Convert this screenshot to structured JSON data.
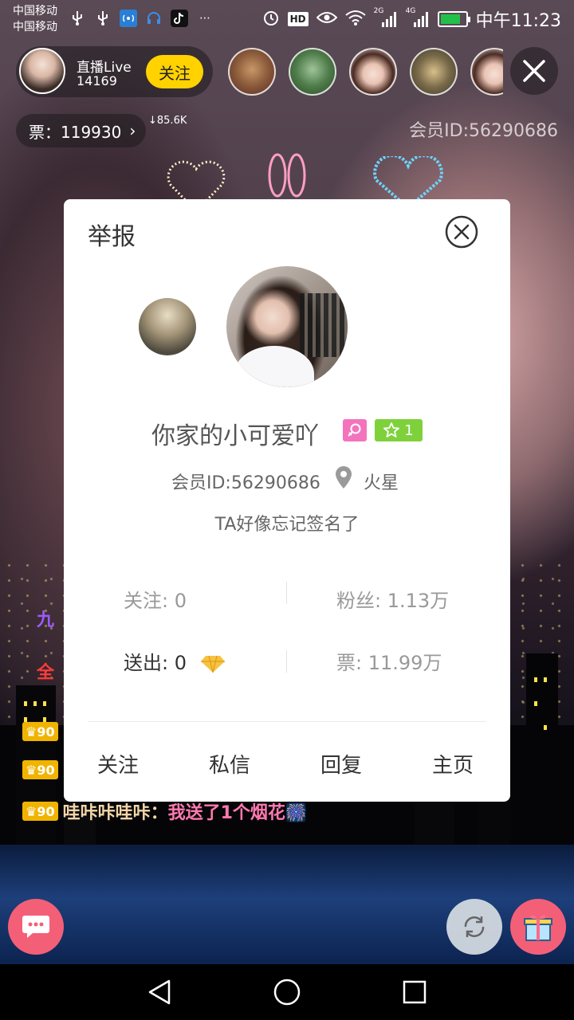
{
  "status_bar": {
    "carrier_1": "中国移动",
    "carrier_2": "中国移动",
    "network_1": "2G",
    "network_2": "4G",
    "hd": "HD",
    "time": "中午11:23",
    "battery_level": 0.8
  },
  "anchor": {
    "title": "直播Live",
    "count": "14169",
    "follow_label": "关注"
  },
  "tickets": {
    "label": "票：119930",
    "speed": "↓85.6K"
  },
  "member_id_top": "会员ID:56290686",
  "chat": [
    {
      "prefix": "九",
      "color": "purple"
    },
    {
      "prefix": "全",
      "color": "red"
    },
    {
      "level": "90"
    },
    {
      "level": "90"
    },
    {
      "level": "90",
      "name": "哇咔咔哇咔：",
      "message": "我送了1个烟花🎆"
    }
  ],
  "modal": {
    "title": "举报",
    "user_name": "你家的小可爱吖",
    "level": "1",
    "member_id": "会员ID:56290686",
    "location": "火星",
    "signature": "TA好像忘记签名了",
    "stats": {
      "following": "关注: 0",
      "fans": "粉丝: 1.13万",
      "sent": "送出: 0",
      "tickets": "票: 11.99万"
    },
    "actions": {
      "follow": "关注",
      "message": "私信",
      "reply": "回复",
      "homepage": "主页"
    }
  },
  "colors": {
    "accent_yellow": "#ffd200",
    "pink_button": "#f45f78",
    "gender_badge": "#f374bd",
    "level_badge": "#7fd13b"
  }
}
